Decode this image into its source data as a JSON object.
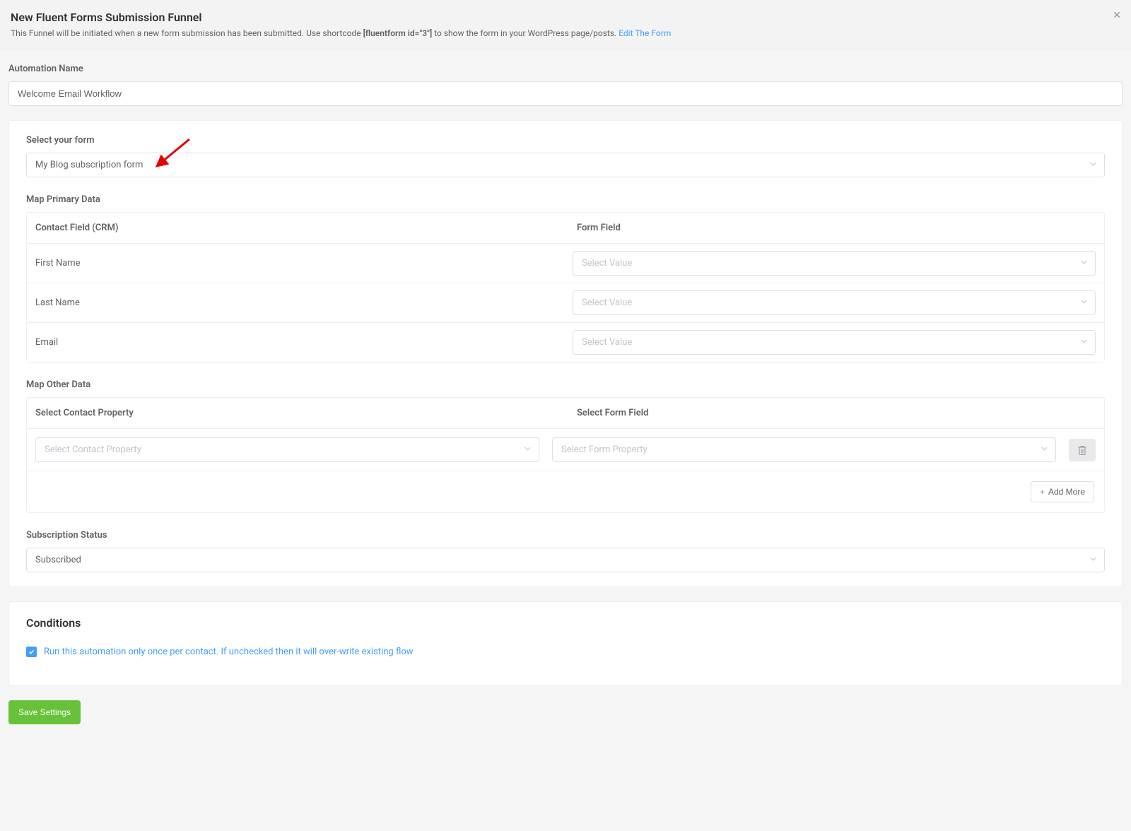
{
  "header": {
    "title": "New Fluent Forms Submission Funnel",
    "description_prefix": "This Funnel will be initiated when a new form submission has been submitted. Use shortcode ",
    "shortcode": "[fluentform id=\"3\"]",
    "description_suffix": " to show the form in your WordPress page/posts. ",
    "edit_link": "Edit The Form"
  },
  "automation_name": {
    "label": "Automation Name",
    "value": "Welcome Email Workflow"
  },
  "select_form": {
    "label": "Select your form",
    "value": "My Blog subscription form"
  },
  "map_primary": {
    "label": "Map Primary Data",
    "header_contact": "Contact Field (CRM)",
    "header_form": "Form Field",
    "select_placeholder": "Select Value",
    "rows": [
      {
        "contact_label": "First Name"
      },
      {
        "contact_label": "Last Name"
      },
      {
        "contact_label": "Email"
      }
    ]
  },
  "map_other": {
    "label": "Map Other Data",
    "header_contact": "Select Contact Property",
    "header_form": "Select Form Field",
    "contact_placeholder": "Select Contact Property",
    "form_placeholder": "Select Form Property",
    "add_more": "Add More"
  },
  "subscription_status": {
    "label": "Subscription Status",
    "value": "Subscribed"
  },
  "conditions": {
    "title": "Conditions",
    "checkbox_label": "Run this automation only once per contact. If unchecked then it will over-write existing flow"
  },
  "save_button": "Save Settings"
}
